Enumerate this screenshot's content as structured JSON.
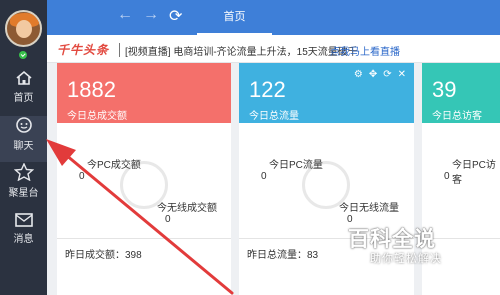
{
  "sidebar": {
    "items": [
      {
        "label": "首页",
        "icon": "home-icon"
      },
      {
        "label": "聊天",
        "icon": "chat-icon"
      },
      {
        "label": "聚星台",
        "icon": "star-icon"
      },
      {
        "label": "消息",
        "icon": "mail-icon"
      }
    ]
  },
  "topbar": {
    "back_icon": "back-arrow-icon",
    "forward_icon": "forward-arrow-icon",
    "refresh_icon": "refresh-icon",
    "tab_label": "首页"
  },
  "announce": {
    "logo": "千牛头条",
    "text": "[视频直播] 电商培训-齐论流量上升法，15天流量破千",
    "link": "点我马上看直播"
  },
  "cards": [
    {
      "value": "1882",
      "label": "今日总成交额",
      "color": "#f4706b",
      "sub1_label": "今PC成交额",
      "sub1_value": "0",
      "sub2_label": "今无线成交额",
      "sub2_value": "0",
      "footer": "昨日成交额：398"
    },
    {
      "value": "122",
      "label": "今日总流量",
      "color": "#3fb1e0",
      "sub1_label": "今日PC流量",
      "sub1_value": "0",
      "sub2_label": "今日无线流量",
      "sub2_value": "0",
      "footer": "昨日总流量：83"
    },
    {
      "value": "39",
      "label": "今日总访客",
      "color": "#35c6b6",
      "sub1_label": "今日PC访客",
      "sub1_value": "0",
      "footer": ""
    }
  ],
  "watermark": {
    "title": "百科全说",
    "subtitle": "助你轻松解决"
  },
  "colors": {
    "sidebar_bg": "#2b3240",
    "topbar_bg": "#3e7fd8",
    "arrow": "#e23b3b"
  }
}
